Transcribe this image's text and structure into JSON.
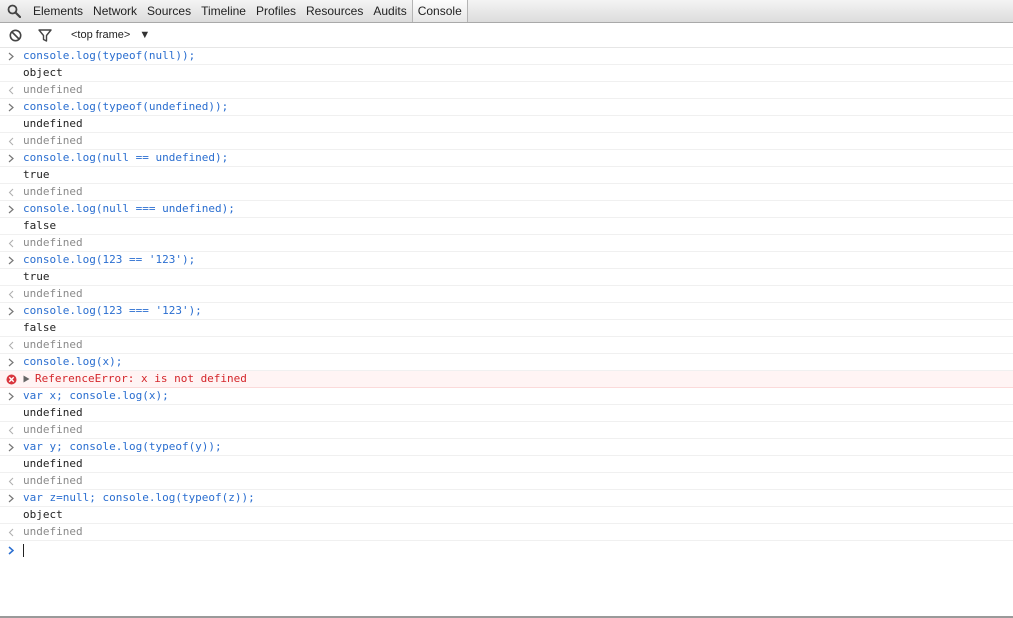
{
  "toolbar": {
    "tabs": [
      {
        "label": "Elements"
      },
      {
        "label": "Network"
      },
      {
        "label": "Sources"
      },
      {
        "label": "Timeline"
      },
      {
        "label": "Profiles"
      },
      {
        "label": "Resources"
      },
      {
        "label": "Audits"
      },
      {
        "label": "Console",
        "active": true
      }
    ]
  },
  "console_toolbar": {
    "frame_label": "<top frame>",
    "frame_arrow": "▼"
  },
  "messages": [
    {
      "type": "cmd",
      "text": "console.log(typeof(null));"
    },
    {
      "type": "out",
      "text": "object"
    },
    {
      "type": "res",
      "text": "undefined"
    },
    {
      "type": "cmd",
      "text": "console.log(typeof(undefined));"
    },
    {
      "type": "out",
      "text": "undefined"
    },
    {
      "type": "res",
      "text": "undefined"
    },
    {
      "type": "cmd",
      "text": "console.log(null == undefined);"
    },
    {
      "type": "out",
      "text": "true"
    },
    {
      "type": "res",
      "text": "undefined"
    },
    {
      "type": "cmd",
      "text": "console.log(null === undefined);"
    },
    {
      "type": "out",
      "text": "false"
    },
    {
      "type": "res",
      "text": "undefined"
    },
    {
      "type": "cmd",
      "text": "console.log(123 == '123');"
    },
    {
      "type": "out",
      "text": "true"
    },
    {
      "type": "res",
      "text": "undefined"
    },
    {
      "type": "cmd",
      "text": "console.log(123 === '123');"
    },
    {
      "type": "out",
      "text": "false"
    },
    {
      "type": "res",
      "text": "undefined"
    },
    {
      "type": "cmd",
      "text": "console.log(x);"
    },
    {
      "type": "err",
      "text": "ReferenceError: x is not defined"
    },
    {
      "type": "cmd",
      "text": "var x; console.log(x);"
    },
    {
      "type": "out",
      "text": "undefined"
    },
    {
      "type": "res",
      "text": "undefined"
    },
    {
      "type": "cmd",
      "text": "var y; console.log(typeof(y));"
    },
    {
      "type": "out",
      "text": "undefined"
    },
    {
      "type": "res",
      "text": "undefined"
    },
    {
      "type": "cmd",
      "text": "var z=null; console.log(typeof(z));"
    },
    {
      "type": "out",
      "text": "object"
    },
    {
      "type": "res",
      "text": "undefined"
    }
  ],
  "colors": {
    "command": "#2a6ed0",
    "output": "#222222",
    "result": "#8a8a8a",
    "error": "#d4262b"
  }
}
